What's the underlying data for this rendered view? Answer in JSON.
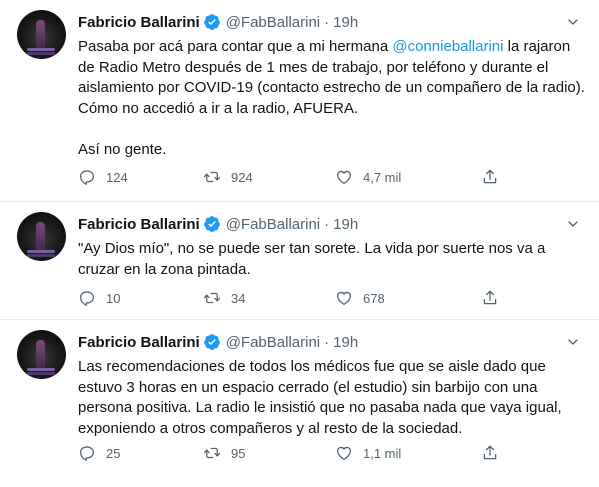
{
  "tweets": [
    {
      "name": "Fabricio Ballarini",
      "handle": "@FabBallarini",
      "dot": "·",
      "time": "19h",
      "text_before": "Pasaba por acá para contar que a mi hermana ",
      "mention": "@connieballarini",
      "text_after": " la rajaron de Radio Metro después de 1 mes de trabajo, por teléfono y durante el aislamiento por COVID-19 (contacto estrecho de un compañero de la radio). Cómo no accedió a ir a la radio, AFUERA.\n\nAsí no gente.",
      "replies": "124",
      "retweets": "924",
      "likes": "4,7 mil"
    },
    {
      "name": "Fabricio Ballarini",
      "handle": "@FabBallarini",
      "dot": "·",
      "time": "19h",
      "text": "\"Ay Dios mío\", no se puede ser tan sorete. La vida por suerte nos va a cruzar en la zona pintada.",
      "replies": "10",
      "retweets": "34",
      "likes": "678"
    },
    {
      "name": "Fabricio Ballarini",
      "handle": "@FabBallarini",
      "dot": "·",
      "time": "19h",
      "text": "Las recomendaciones de todos los médicos fue que se aisle dado que estuvo 3 horas en un espacio cerrado (el estudio) sin barbijo con una persona positiva. La radio le insistió que no pasaba nada que vaya igual, exponiendo a otros compañeros y al resto de la sociedad.",
      "replies": "25",
      "retweets": "95",
      "likes": "1,1 mil"
    }
  ],
  "colors": {
    "accent": "#1b95e0",
    "verified": "#1d9bf0",
    "muted": "#536471",
    "text": "#0f1419",
    "divider": "#e6ecf0"
  },
  "icons": [
    "avatar",
    "verified-badge-icon",
    "more-caret-icon",
    "reply-icon",
    "retweet-icon",
    "like-icon",
    "share-icon"
  ]
}
